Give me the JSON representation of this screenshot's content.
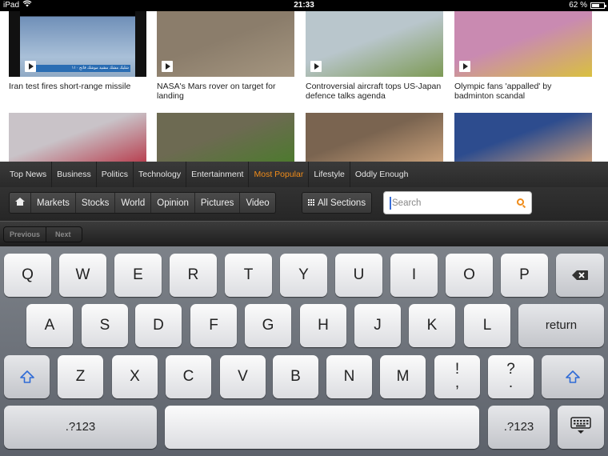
{
  "status": {
    "device": "iPad",
    "time": "21:33",
    "battery": "62 %",
    "battery_level": 0.62
  },
  "articles": [
    {
      "title": "Iran test fires short-range missile",
      "thumb_colors": [
        "#6f8fb8",
        "#a9c0d8"
      ],
      "has_video": true,
      "overlay_text": "‫شليك مشك مشيد موشك فاتح ١١٠‬"
    },
    {
      "title": "NASA's Mars rover on target for landing",
      "thumb_colors": [
        "#8b7d6b",
        "#a59680"
      ],
      "has_video": true
    },
    {
      "title": "Controversial aircraft tops US-Japan defence talks agenda",
      "thumb_colors": [
        "#b9c6cc",
        "#7d9a55"
      ],
      "has_video": true
    },
    {
      "title": "Olympic fans 'appalled' by badminton scandal",
      "thumb_colors": [
        "#c98ab1",
        "#d9c040"
      ],
      "has_video": true
    },
    {
      "title": "",
      "thumb_colors": [
        "#c9c3c8",
        "#b84050"
      ],
      "has_video": false
    },
    {
      "title": "",
      "thumb_colors": [
        "#6d6a52",
        "#4d7a2e"
      ],
      "has_video": false
    },
    {
      "title": "",
      "thumb_colors": [
        "#7a6450",
        "#c8a07a"
      ],
      "has_video": false
    },
    {
      "title": "",
      "thumb_colors": [
        "#2d4c8e",
        "#c79b7a"
      ],
      "has_video": false
    }
  ],
  "nav": {
    "items": [
      "Top News",
      "Business",
      "Politics",
      "Technology",
      "Entertainment",
      "Most Popular",
      "Lifestyle",
      "Oddly Enough"
    ],
    "active": "Most Popular"
  },
  "subnav": {
    "items": [
      "Markets",
      "Stocks",
      "World",
      "Opinion",
      "Pictures",
      "Video"
    ],
    "all_sections": "All Sections",
    "search_placeholder": "Search",
    "search_value": ""
  },
  "form_assistant": {
    "previous": "Previous",
    "next": "Next"
  },
  "keyboard": {
    "row1": [
      "Q",
      "W",
      "E",
      "R",
      "T",
      "Y",
      "U",
      "I",
      "O",
      "P"
    ],
    "row2": [
      "A",
      "S",
      "D",
      "F",
      "G",
      "H",
      "J",
      "K",
      "L"
    ],
    "row3": [
      "Z",
      "X",
      "C",
      "V",
      "B",
      "N",
      "M"
    ],
    "exclaim": [
      "!",
      ","
    ],
    "question": [
      "?",
      "."
    ],
    "return_label": "return",
    "numbers_label": ".?123"
  },
  "colors": {
    "accent": "#f08c1a",
    "navbar": "#2f2f2f",
    "keyboard_bg": "#6b7078"
  }
}
